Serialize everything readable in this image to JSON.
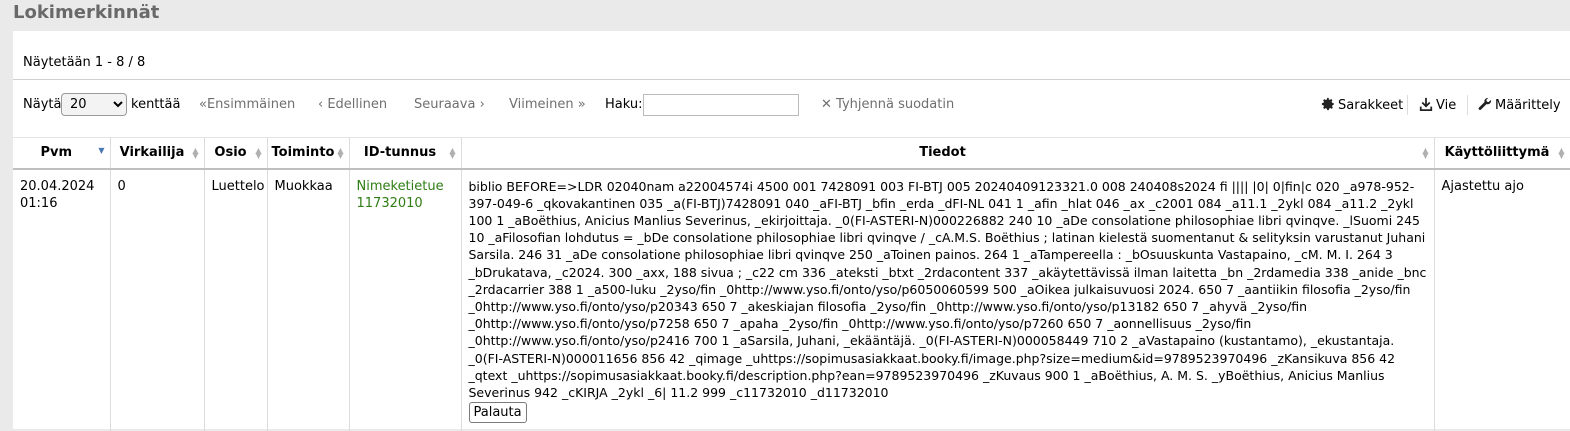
{
  "page": {
    "title": "Lokimerkinnät"
  },
  "table_info": "Näytetään 1 - 8 / 8",
  "toolbar": {
    "show_label": "Näytä",
    "page_length": "20",
    "entries_label": "kenttää",
    "first": "Ensimmäinen",
    "previous": "Edellinen",
    "next": "Seuraava",
    "last": "Viimeinen",
    "search_label": "Haku:",
    "search_value": "",
    "clear_filter": "Tyhjennä suodatin",
    "columns": "Sarakkeet",
    "export": "Vie",
    "config": "Määrittely"
  },
  "columns": [
    "Pvm",
    "Virkailija",
    "Osio",
    "Toiminto",
    "ID-tunnus",
    "Tiedot",
    "Käyttöliittymä"
  ],
  "rows": [
    {
      "date": "20.04.2024",
      "time": "01:16",
      "librarian": "0",
      "module": "Luettelo",
      "action": "Muokkaa",
      "object_type": "Nimeketietue",
      "object_id": "11732010",
      "info": "biblio BEFORE=>LDR 02040nam a22004574i 4500 001 7428091 003 FI-BTJ 005 20240409123321.0 008 240408s2024 fi |||| |0| 0|fin|c 020 _a978-952-397-049-6 _qkovakantinen 035 _a(FI-BTJ)7428091 040 _aFI-BTJ _bfin _erda _dFI-NL 041 1 _afin _hlat 046 _ax _c2001 084 _a11.1 _2ykl 084 _a11.2 _2ykl 100 1 _aBoëthius, Anicius Manlius Severinus, _ekirjoittaja. _0(FI-ASTERI-N)000226882 240 10 _aDe consolatione philosophiae libri qvinqve. _lSuomi 245 10 _aFilosofian lohdutus = _bDe consolatione philosophiae libri qvinqve / _cA.M.S. Boëthius ; latinan kielestä suomentanut & selityksin varustanut Juhani Sarsila. 246 31 _aDe consolatione philosophiae libri qvinqve 250 _aToinen painos. 264 1 _aTampereella : _bOsuuskunta Vastapaino, _cM. M. I. 264 3 _bDrukatava, _c2024. 300 _axx, 188 sivua ; _c22 cm 336 _ateksti _btxt _2rdacontent 337 _akäytettävissä ilman laitetta _bn _2rdamedia 338 _anide _bnc _2rdacarrier 388 1 _a500-luku _2yso/fin _0http://www.yso.fi/onto/yso/p6050060599 500 _aOikea julkaisuvuosi 2024. 650 7 _aantiikin filosofia _2yso/fin _0http://www.yso.fi/onto/yso/p20343 650 7 _akeskiajan filosofia _2yso/fin _0http://www.yso.fi/onto/yso/p13182 650 7 _ahyvä _2yso/fin _0http://www.yso.fi/onto/yso/p7258 650 7 _apaha _2yso/fin _0http://www.yso.fi/onto/yso/p7260 650 7 _aonnellisuus _2yso/fin _0http://www.yso.fi/onto/yso/p2416 700 1 _aSarsila, Juhani, _ekääntäjä. _0(FI-ASTERI-N)000058449 710 2 _aVastapaino (kustantamo), _ekustantaja. _0(FI-ASTERI-N)000011656 856 42 _qimage _uhttps://sopimusasiakkaat.booky.fi/image.php?size=medium&id=9789523970496 _zKansikuva 856 42 _qtext _uhttps://sopimusasiakkaat.booky.fi/description.php?ean=9789523970496 _zKuvaus 900 1 _aBoëthius, A. M. S. _yBoëthius, Anicius Manlius Severinus 942 _cKIRJA _2ykl _6| 11.2 999 _c11732010 _d11732010",
      "restore_button": "Palauta",
      "interface": "Ajastettu ajo"
    }
  ],
  "colors": {
    "accent_sort": "#4a78b5",
    "link_green": "#2f7d14",
    "background": "#eaeaea"
  }
}
